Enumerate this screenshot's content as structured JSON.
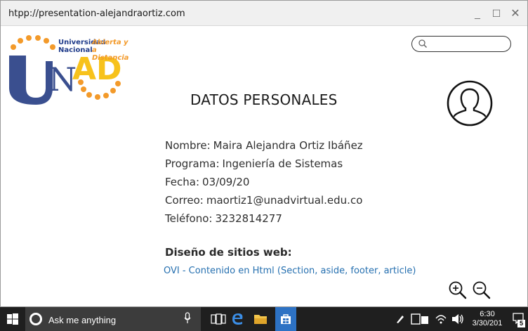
{
  "window": {
    "url": "htpp://presentation-alejandraortiz.com",
    "controls": {
      "minimize": "_",
      "maximize": "☐",
      "close": "✕"
    }
  },
  "logo": {
    "line1_left": "Universidad",
    "line1_right": "Abierta y",
    "line2_left": "Nacional",
    "line2_right": "a Distancia",
    "letters_u": "U",
    "letters_n": "N",
    "letters_ad": "AD",
    "colors": {
      "blue": "#3a4f8f",
      "orange": "#f39a2a",
      "yellow": "#f7c21b"
    }
  },
  "search": {
    "placeholder": "",
    "value": ""
  },
  "page": {
    "title": "DATOS PERSONALES"
  },
  "profile": {
    "nombre_label": "Nombre:",
    "nombre": "Maira Alejandra Ortiz Ibáñez",
    "programa_label": "Programa:",
    "programa": "Ingeniería de Sistemas",
    "fecha_label": "Fecha:",
    "fecha": "03/09/20",
    "correo_label": "Correo:",
    "correo": "maortiz1@unadvirtual.edu.co",
    "telefono_label": "Teléfono:",
    "telefono": "3232814277"
  },
  "section": {
    "title": "Diseño de sitios web:",
    "link": "OVI - Contenido en Html (Section, aside, footer, article)"
  },
  "icons": {
    "search": "search-icon",
    "avatar": "user-avatar-icon",
    "zoom_in": "zoom-in-icon",
    "zoom_out": "zoom-out-icon"
  },
  "taskbar": {
    "search_text": "Ask me anything",
    "time": "6:30",
    "date": "3/30/201",
    "notification_count": "5",
    "accent": "#2d72c4"
  }
}
